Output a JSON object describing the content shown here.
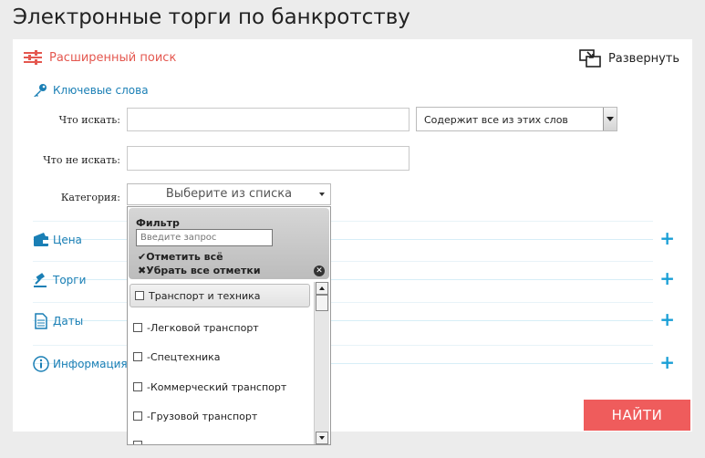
{
  "page_title": "Электронные торги по банкротству",
  "advanced_search": {
    "label": "Расширенный поиск",
    "icon": "sliders-icon"
  },
  "expand": {
    "label": "Развернуть",
    "icon": "expand-window-icon"
  },
  "keywords": {
    "title": "Ключевые слова",
    "what_label": "Что искать:",
    "what_value": "",
    "mode_value": "Содержит все из этих слов",
    "not_label": "Что не искать:",
    "not_value": "",
    "category_label": "Категория:",
    "category_value": "Выберите из списка"
  },
  "sections": [
    {
      "name": "Цена",
      "icon": "wallet-icon"
    },
    {
      "name": "Торги",
      "icon": "gavel-icon"
    },
    {
      "name": "Даты",
      "icon": "document-icon"
    },
    {
      "name": "Информация",
      "icon": "info-icon"
    }
  ],
  "find_button": "НАЙТИ",
  "dropdown": {
    "filter_label": "Фильтр",
    "filter_placeholder": "Введите запрос",
    "select_all": "Отметить всё",
    "clear_all": "Убрать все отметки",
    "items": [
      "Транспорт и техника",
      "-Легковой транспорт",
      "-Спецтехника",
      "-Коммерческий транспорт",
      "-Грузовой транспорт"
    ]
  },
  "colors": {
    "accent_red": "#ef5c5c",
    "link_blue": "#1a7fb5",
    "plus_blue": "#1a9fd6"
  }
}
